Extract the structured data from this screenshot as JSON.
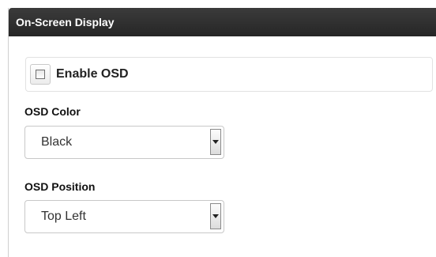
{
  "panel": {
    "title": "On-Screen Display"
  },
  "enable_osd": {
    "label": "Enable OSD",
    "checked": false
  },
  "osd_color": {
    "label": "OSD Color",
    "value": "Black"
  },
  "osd_position": {
    "label": "OSD Position",
    "value": "Top Left"
  }
}
